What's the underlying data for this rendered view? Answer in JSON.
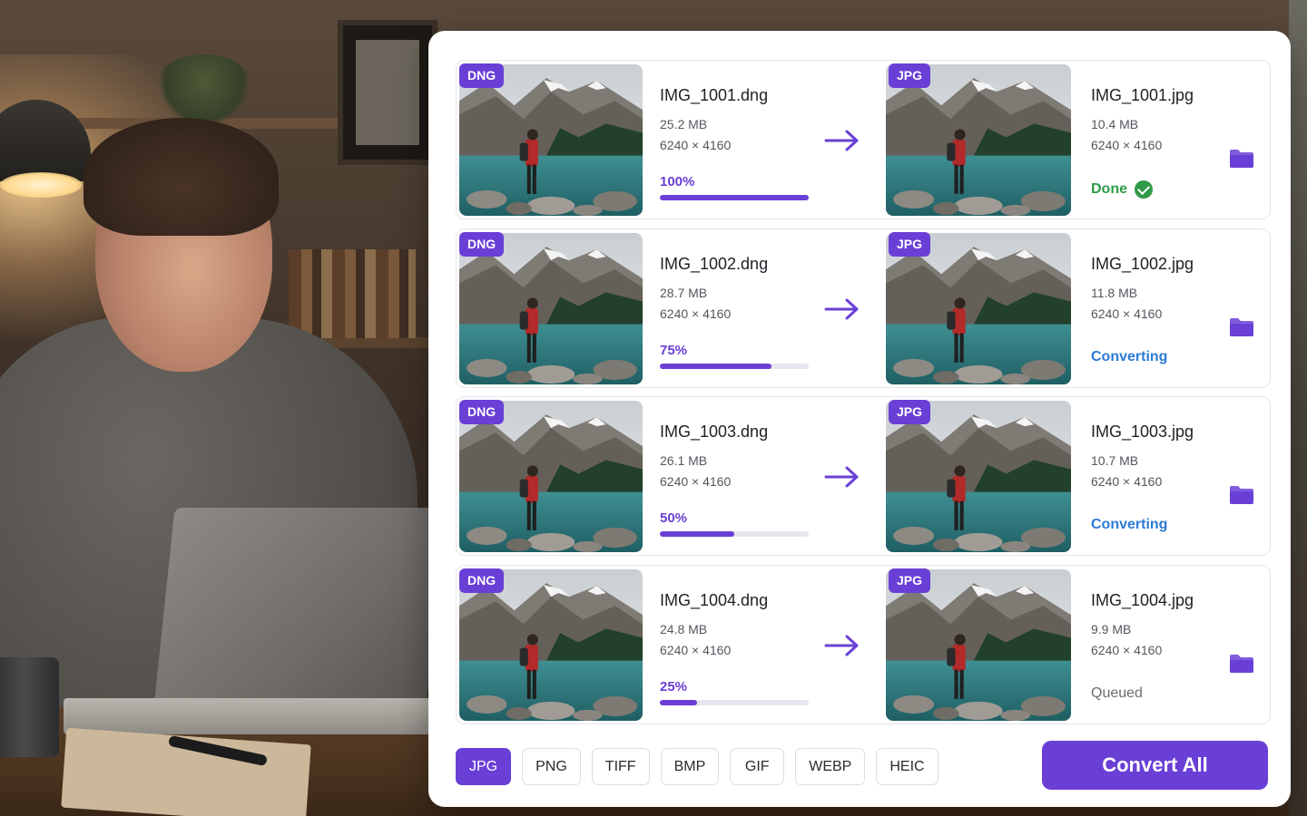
{
  "files": [
    {
      "source": {
        "badge": "DNG",
        "name": "IMG_1001.dng",
        "size": "25.2 MB",
        "dimensions": "6240 × 4160",
        "progress_label": "100%",
        "progress": 1.0
      },
      "output": {
        "badge": "JPG",
        "name": "IMG_1001.jpg",
        "size": "10.4 MB",
        "dimensions": "6240 × 4160",
        "status": "Done",
        "status_kind": "done"
      }
    },
    {
      "source": {
        "badge": "DNG",
        "name": "IMG_1002.dng",
        "size": "28.7 MB",
        "dimensions": "6240 × 4160",
        "progress_label": "75%",
        "progress": 0.75
      },
      "output": {
        "badge": "JPG",
        "name": "IMG_1002.jpg",
        "size": "11.8 MB",
        "dimensions": "6240 × 4160",
        "status": "Converting",
        "status_kind": "converting"
      }
    },
    {
      "source": {
        "badge": "DNG",
        "name": "IMG_1003.dng",
        "size": "26.1 MB",
        "dimensions": "6240 × 4160",
        "progress_label": "50%",
        "progress": 0.5
      },
      "output": {
        "badge": "JPG",
        "name": "IMG_1003.jpg",
        "size": "10.7 MB",
        "dimensions": "6240 × 4160",
        "status": "Converting",
        "status_kind": "converting"
      }
    },
    {
      "source": {
        "badge": "DNG",
        "name": "IMG_1004.dng",
        "size": "24.8 MB",
        "dimensions": "6240 × 4160",
        "progress_label": "25%",
        "progress": 0.25
      },
      "output": {
        "badge": "JPG",
        "name": "IMG_1004.jpg",
        "size": "9.9 MB",
        "dimensions": "6240 × 4160",
        "status": "Queued",
        "status_kind": "queued"
      }
    }
  ],
  "formats": {
    "selected": "JPG",
    "options": [
      "JPG",
      "PNG",
      "TIFF",
      "BMP",
      "GIF",
      "WEBP",
      "HEIC"
    ]
  },
  "convert_all_label": "Convert All",
  "icons": {
    "arrow": "arrow-right-icon",
    "folder": "folder-icon",
    "done": "check-circle-icon"
  },
  "colors": {
    "accent": "#6a3fd6",
    "done": "#2f9a47",
    "converting": "#2d7ad6",
    "queued": "#6b6b72"
  }
}
